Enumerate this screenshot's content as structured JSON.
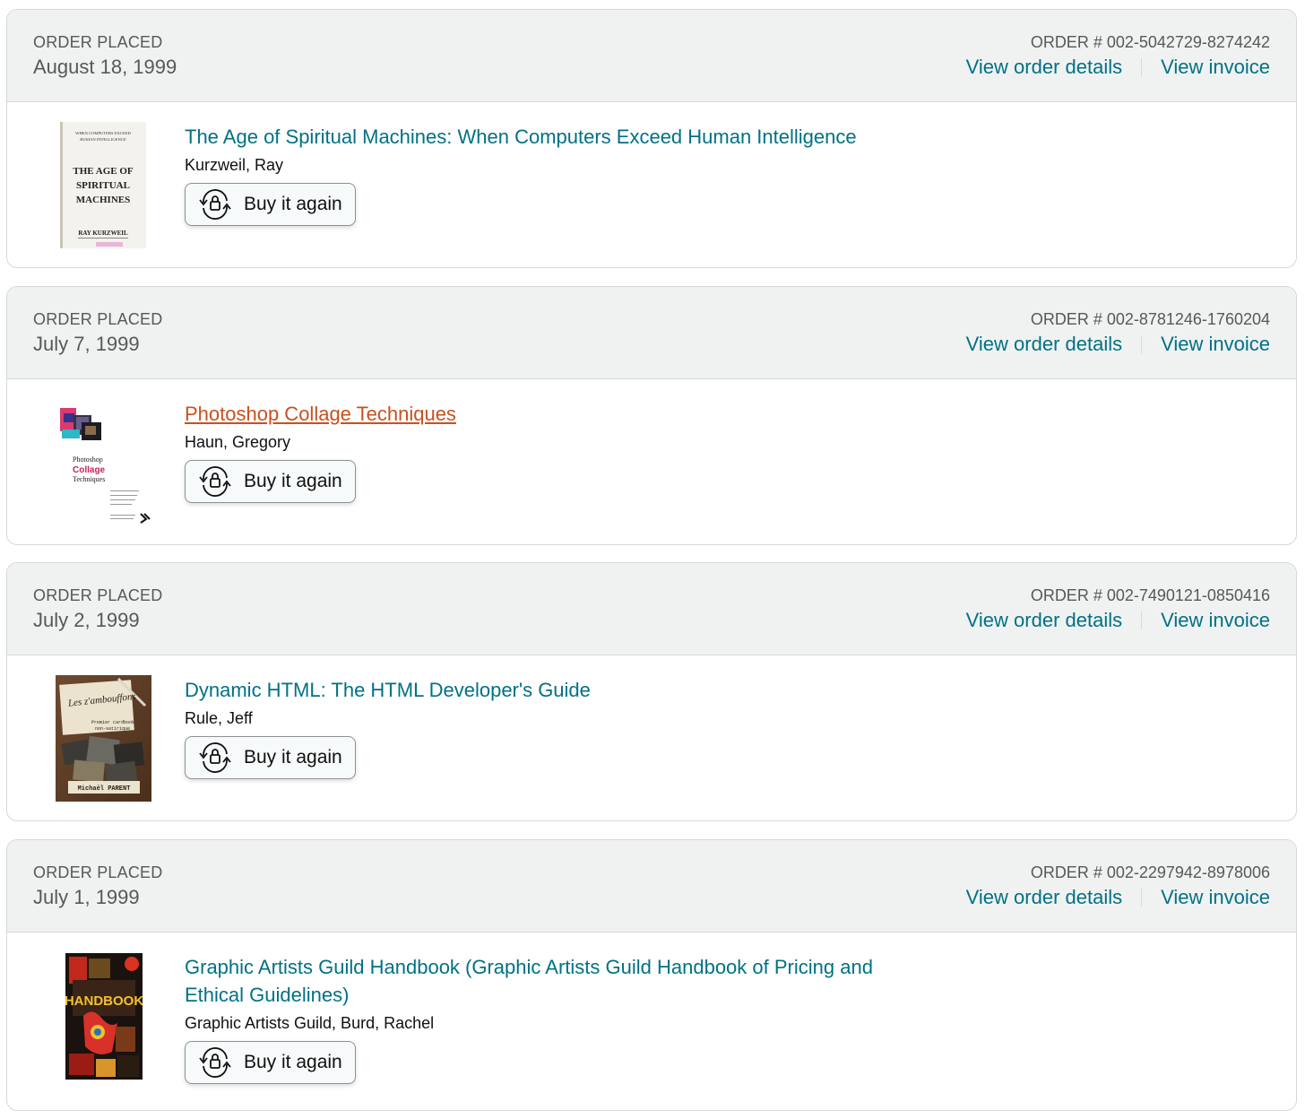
{
  "orders": [
    {
      "placed_label": "ORDER PLACED",
      "date": "August 18, 1999",
      "order_number": "ORDER # 002-5042729-8274242",
      "details_link": "View order details",
      "invoice_link": "View invoice",
      "item": {
        "title": "The Age of Spiritual Machines: When Computers Exceed Human Intelligence",
        "author": "Kurzweil, Ray",
        "buy_again": "Buy it again"
      }
    },
    {
      "placed_label": "ORDER PLACED",
      "date": "July 7, 1999",
      "order_number": "ORDER # 002-8781246-1760204",
      "details_link": "View order details",
      "invoice_link": "View invoice",
      "item": {
        "title": "Photoshop Collage Techniques",
        "author": "Haun, Gregory",
        "buy_again": "Buy it again"
      }
    },
    {
      "placed_label": "ORDER PLACED",
      "date": "July 2, 1999",
      "order_number": "ORDER # 002-7490121-0850416",
      "details_link": "View order details",
      "invoice_link": "View invoice",
      "item": {
        "title": "Dynamic HTML: The HTML Developer's Guide",
        "author": "Rule, Jeff",
        "buy_again": "Buy it again"
      }
    },
    {
      "placed_label": "ORDER PLACED",
      "date": "July 1, 1999",
      "order_number": "ORDER # 002-2297942-8978006",
      "details_link": "View order details",
      "invoice_link": "View invoice",
      "item": {
        "title": "Graphic Artists Guild Handbook (Graphic Artists Guild Handbook of Pricing and Ethical Guidelines)",
        "author": "Graphic Artists Guild, Burd, Rachel",
        "buy_again": "Buy it again"
      }
    }
  ],
  "covers": {
    "c1": {
      "top_small_1": "WHEN COMPUTERS EXCEED",
      "top_small_2": "HUMAN INTELLIGENCE",
      "line1": "THE AGE OF",
      "line2": "SPIRITUAL",
      "line3": "MACHINES",
      "author": "RAY KURZWEIL"
    },
    "c2": {
      "line1": "Photoshop",
      "line2": "Collage",
      "line3": "Techniques"
    },
    "c3": {
      "script": "Les z'ambouffons",
      "sub1": "Premier cardbook",
      "sub2": "non-satirique",
      "author": "Michaël PARENT"
    },
    "c4": {
      "text": "HANDBOOK"
    }
  },
  "colors": {
    "link": "#007185",
    "link_hover": "#c7511f",
    "header_bg": "#f0f2f2",
    "border": "#d5d9d9"
  },
  "icons": {
    "buy_again": "buy-again-cycle-icon"
  }
}
